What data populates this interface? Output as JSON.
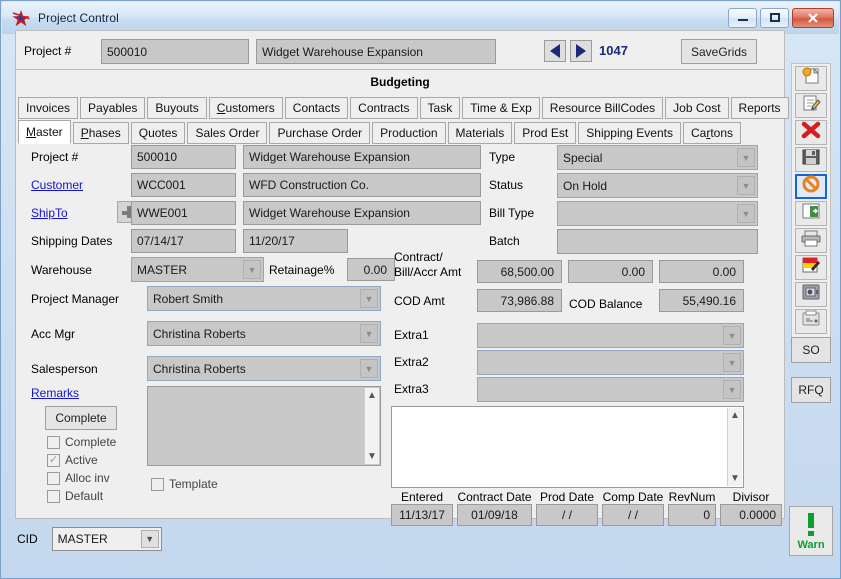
{
  "window": {
    "title": "Project Control",
    "app_icon": "star-icon",
    "minimize": "minimize-icon",
    "maximize": "maximize-icon",
    "close": "close-icon"
  },
  "header": {
    "project_label": "Project #",
    "project_number": "500010",
    "project_name": "Widget Warehouse Expansion",
    "prev_label": "prev-record-icon",
    "next_label": "next-record-icon",
    "record_number": "1047",
    "save_grids": "SaveGrids"
  },
  "section_title": "Budgeting",
  "tabs_row1": [
    {
      "label": "Invoices",
      "accel": "",
      "active": false
    },
    {
      "label": "Payables",
      "accel": "",
      "active": false
    },
    {
      "label": "Buyouts",
      "accel": "",
      "active": false
    },
    {
      "label": "Customers",
      "accel": "C",
      "active": false
    },
    {
      "label": "Contacts",
      "accel": "",
      "active": false
    },
    {
      "label": "Contracts",
      "accel": "",
      "active": false
    },
    {
      "label": "Task",
      "accel": "",
      "active": false
    },
    {
      "label": "Time & Exp",
      "accel": "",
      "active": false
    },
    {
      "label": "Resource BillCodes",
      "accel": "",
      "active": false
    },
    {
      "label": "Job Cost",
      "accel": "",
      "active": false
    },
    {
      "label": "Reports",
      "accel": "",
      "active": false
    }
  ],
  "tabs_row2": [
    {
      "label": "Master",
      "accel": "M",
      "active": true
    },
    {
      "label": "Phases",
      "accel": "P",
      "active": false
    },
    {
      "label": "Quotes",
      "accel": "",
      "active": false
    },
    {
      "label": "Sales Order",
      "accel": "",
      "active": false
    },
    {
      "label": "Purchase Order",
      "accel": "",
      "active": false
    },
    {
      "label": "Production",
      "accel": "",
      "active": false
    },
    {
      "label": "Materials",
      "accel": "",
      "active": false
    },
    {
      "label": "Prod Est",
      "accel": "",
      "active": false
    },
    {
      "label": "Shipping Events",
      "accel": "",
      "active": false
    },
    {
      "label": "Cartons",
      "accel": "r",
      "active": false
    }
  ],
  "form": {
    "project_label": "Project #",
    "project_code": "500010",
    "project_desc": "Widget Warehouse Expansion",
    "customer_label": "Customer",
    "customer_code": "WCC001",
    "customer_name": "WFD Construction Co.",
    "shipto_label": "ShipTo",
    "shipto_add": "add-shipto-icon",
    "shipto_code": "WWE001",
    "shipto_name": "Widget Warehouse Expansion",
    "shipping_dates_label": "Shipping Dates",
    "ship_date_from": "07/14/17",
    "ship_date_to": "11/20/17",
    "warehouse_label": "Warehouse",
    "warehouse_value": "MASTER",
    "retainage_label": "Retainage%",
    "retainage_value": "0.00",
    "project_manager_label": "Project Manager",
    "project_manager_value": "Robert Smith",
    "acc_mgr_label": "Acc Mgr",
    "acc_mgr_value": "Christina Roberts",
    "salesperson_label": "Salesperson",
    "salesperson_value": "Christina Roberts",
    "remarks_label": "Remarks",
    "remarks_value": "",
    "complete_button": "Complete",
    "checkboxes": [
      {
        "label": "Complete",
        "checked": false
      },
      {
        "label": "Active",
        "checked": true
      },
      {
        "label": "Alloc inv",
        "checked": false
      },
      {
        "label": "Default",
        "checked": false
      }
    ],
    "template_label": "Template",
    "template_checked": false,
    "type_label": "Type",
    "type_value": "Special",
    "status_label": "Status",
    "status_value": "On Hold",
    "bill_type_label": "Bill Type",
    "bill_type_value": "",
    "batch_label": "Batch",
    "batch_value": "",
    "contract_label_line1": "Contract/",
    "contract_label_line2": "Bill/Accr Amt",
    "contract_amt": "68,500.00",
    "bill_amt": "0.00",
    "accr_amt": "0.00",
    "cod_amt_label": "COD Amt",
    "cod_amt": "73,986.88",
    "cod_balance_label": "COD Balance",
    "cod_balance": "55,490.16",
    "extra1_label": "Extra1",
    "extra1_value": "",
    "extra2_label": "Extra2",
    "extra2_value": "",
    "extra3_label": "Extra3",
    "extra3_value": "",
    "notes_value": "",
    "dates": [
      {
        "label": "Entered",
        "value": "11/13/17",
        "align": "center"
      },
      {
        "label": "Contract Date",
        "value": "01/09/18",
        "align": "center"
      },
      {
        "label": "Prod Date",
        "value": "/  /",
        "align": "center"
      },
      {
        "label": "Comp Date",
        "value": "/  /",
        "align": "center"
      },
      {
        "label": "RevNum",
        "value": "0",
        "align": "right"
      },
      {
        "label": "Divisor",
        "value": "0.0000",
        "align": "right"
      }
    ]
  },
  "toolbar": {
    "group1": [
      {
        "name": "new-record-icon",
        "selected": false
      },
      {
        "name": "edit-record-icon",
        "selected": false
      },
      {
        "name": "delete-record-icon",
        "selected": false
      },
      {
        "name": "save-record-icon",
        "selected": false
      },
      {
        "name": "cancel-record-icon",
        "selected": true
      },
      {
        "name": "exit-icon",
        "selected": false
      },
      {
        "name": "print-icon",
        "selected": false
      },
      {
        "name": "notes-icon",
        "selected": false
      },
      {
        "name": "safe-icon",
        "selected": false
      },
      {
        "name": "fax-icon",
        "selected": false
      }
    ],
    "so_button": "SO",
    "rfq_button": "RFQ"
  },
  "footer": {
    "cid_label": "CID",
    "cid_value": "MASTER",
    "warn_label": "Warn",
    "warn_icon": "warning-exclamation-icon"
  },
  "colors": {
    "accent_blue": "#1b2a78",
    "link_blue": "#1414d2",
    "warn_green": "#0ba02c",
    "field_gray": "#c8c8c8",
    "panel_gray": "#efefef",
    "close_red": "#d15a41"
  }
}
